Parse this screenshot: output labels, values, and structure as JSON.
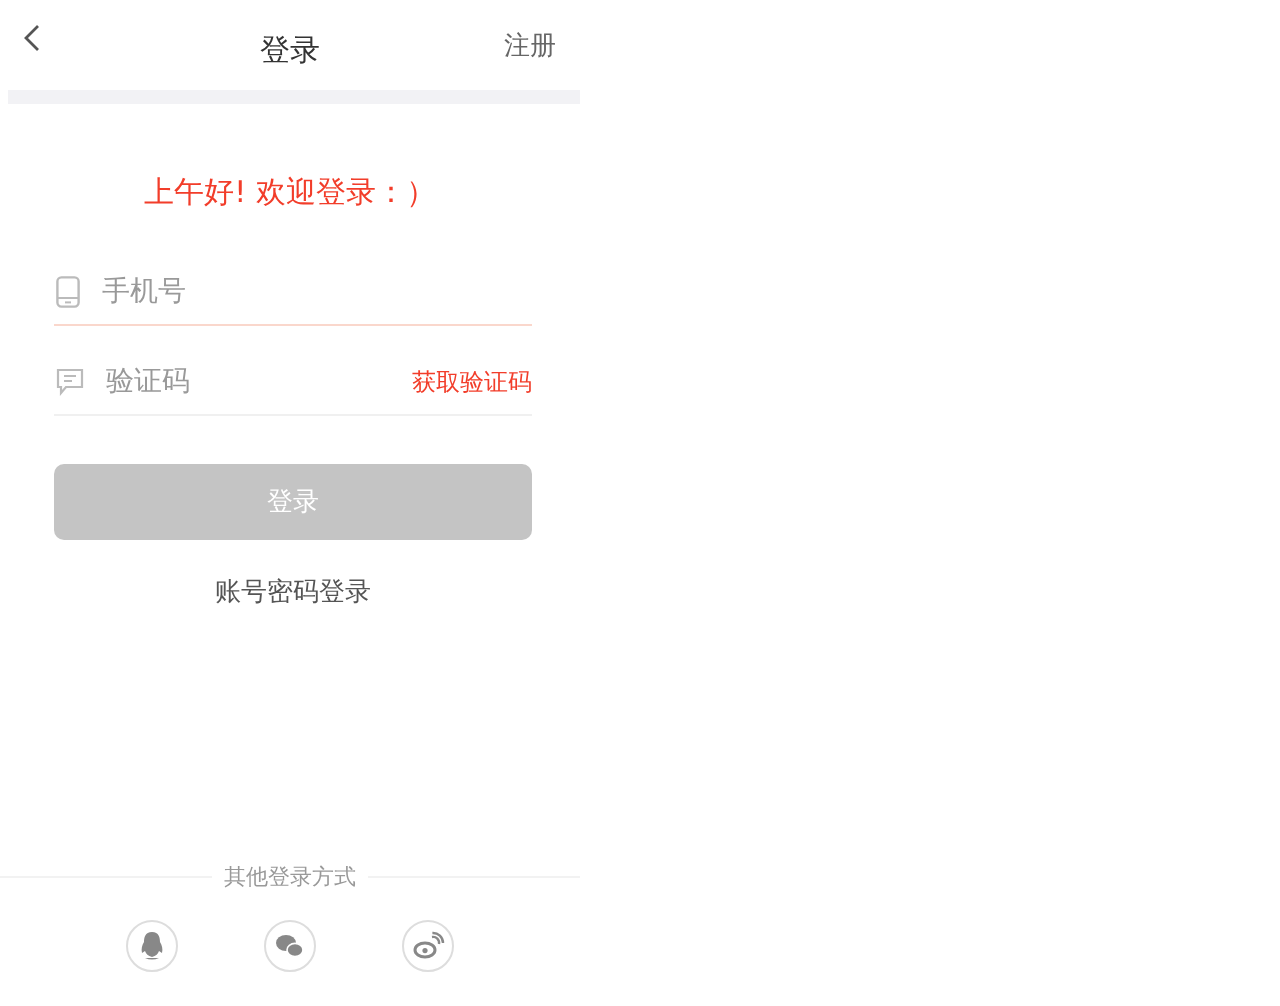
{
  "nav": {
    "title": "登录",
    "right": "注册"
  },
  "greeting": "上午好! 欢迎登录：）",
  "fields": [
    {
      "kind": "phone",
      "placeholder": "手机号",
      "focused": true
    },
    {
      "kind": "code",
      "placeholder": "验证码",
      "focused": false,
      "action": "获取验证码"
    }
  ],
  "login_button": {
    "label": "登录",
    "disabled": true
  },
  "alt_link": "账号密码登录",
  "other": {
    "label": "其他登录方式",
    "providers": [
      {
        "kind": "penguin"
      },
      {
        "kind": "chat"
      },
      {
        "kind": "swirl"
      }
    ]
  }
}
